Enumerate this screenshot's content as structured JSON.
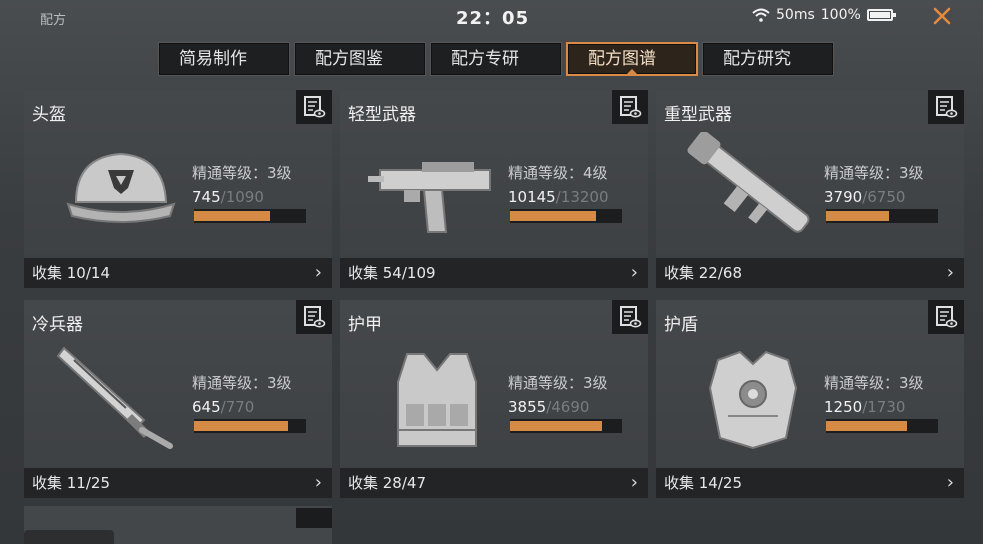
{
  "header": {
    "title": "配方",
    "time": "22：05",
    "ping": "50ms",
    "battery": "100%"
  },
  "tabs": [
    {
      "label": "简易制作"
    },
    {
      "label": "配方图鉴"
    },
    {
      "label": "配方专研"
    },
    {
      "label": "配方图谱",
      "active": true
    },
    {
      "label": "配方研究"
    }
  ],
  "cards": [
    {
      "name": "头盔",
      "mastery": "精通等级：3级",
      "current": "745",
      "max": "/1090",
      "progress": 0.68,
      "collect": "收集 10/14",
      "icon": "helmet-icon"
    },
    {
      "name": "轻型武器",
      "mastery": "精通等级：4级",
      "current": "10145",
      "max": "/13200",
      "progress": 0.77,
      "collect": "收集 54/109",
      "icon": "smg-icon"
    },
    {
      "name": "重型武器",
      "mastery": "精通等级：3级",
      "current": "3790",
      "max": "/6750",
      "progress": 0.56,
      "collect": "收集 22/68",
      "icon": "rocket-launcher-icon"
    },
    {
      "name": "冷兵器",
      "mastery": "精通等级：3级",
      "current": "645",
      "max": "/770",
      "progress": 0.84,
      "collect": "收集 11/25",
      "icon": "blade-icon"
    },
    {
      "name": "护甲",
      "mastery": "精通等级：3级",
      "current": "3855",
      "max": "/4690",
      "progress": 0.82,
      "collect": "收集 28/47",
      "icon": "vest-icon"
    },
    {
      "name": "护盾",
      "mastery": "精通等级：3级",
      "current": "1250",
      "max": "/1730",
      "progress": 0.72,
      "collect": "收集 14/25",
      "icon": "shield-armor-icon"
    }
  ],
  "colors": {
    "accent": "#d98a44",
    "close": "#e48a3d",
    "bar_fill": "#d58a45"
  }
}
